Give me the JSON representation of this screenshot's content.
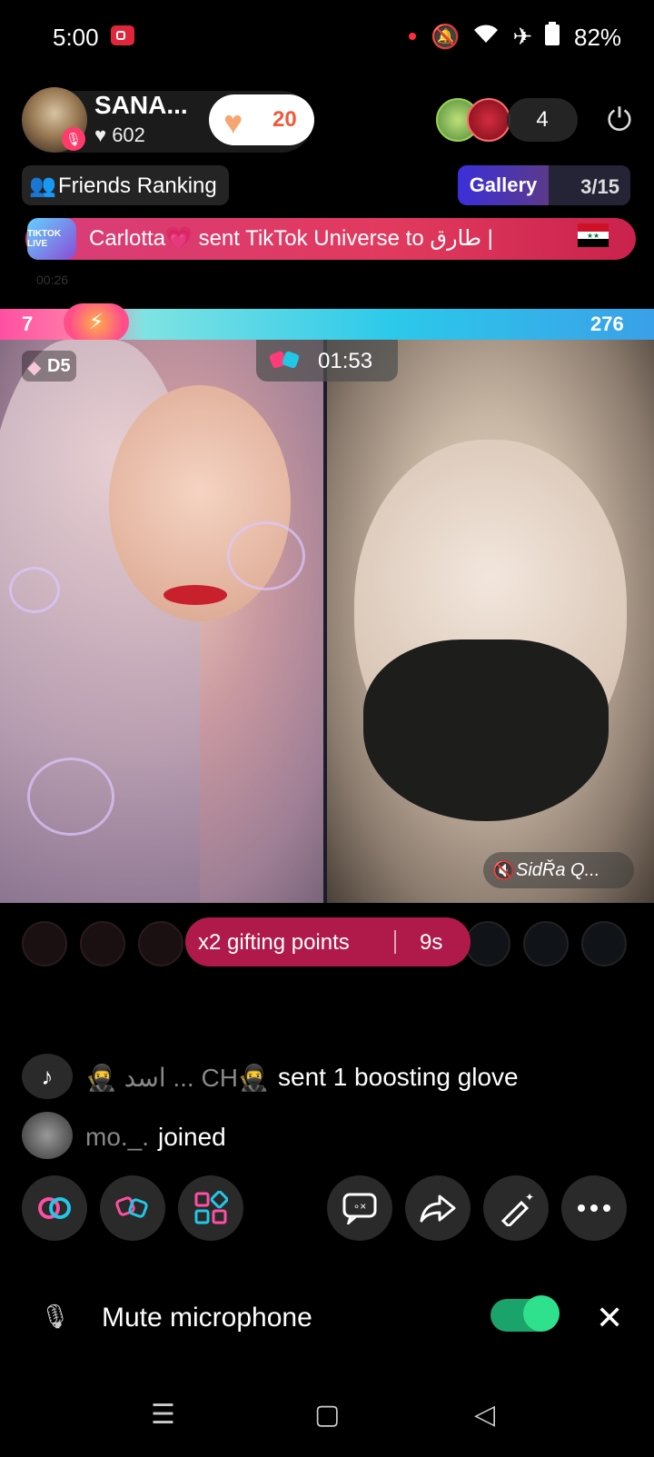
{
  "status": {
    "time": "5:00",
    "battery": "82%"
  },
  "host": {
    "name": "SANA...",
    "likes": "602",
    "heart_count": "20"
  },
  "viewers": {
    "count": "4"
  },
  "friends_ranking": {
    "label": "Friends Ranking"
  },
  "gallery": {
    "label": "Gallery",
    "count": "3/15"
  },
  "gift_banner": {
    "icon_text": "TIKTOK LIVE",
    "text": "Carlotta💗 sent TikTok Universe to طارق |"
  },
  "banner_time": "00:26",
  "battle": {
    "left_score": "7",
    "right_score": "276",
    "timer": "01:53",
    "left_badge": "D5",
    "right_name": "SidŘa Q..."
  },
  "gifting": {
    "label": "x2 gifting points",
    "seconds": "9s"
  },
  "chat": [
    {
      "user": "🥷 اسد ... CH🥷",
      "message": "sent 1 boosting glove"
    },
    {
      "user": "mo._.",
      "message": "joined"
    }
  ],
  "toolbar_icons": [
    "link-icon",
    "multi-guest-icon",
    "more-apps-icon",
    "chat-settings-icon",
    "share-icon",
    "effects-icon",
    "more-icon"
  ],
  "mute_row": {
    "label": "Mute microphone",
    "toggle_on": true
  },
  "colors": {
    "accent": "#e23a5e",
    "gift_pill": "#b01a4a",
    "toggle": "#2fe08c"
  }
}
